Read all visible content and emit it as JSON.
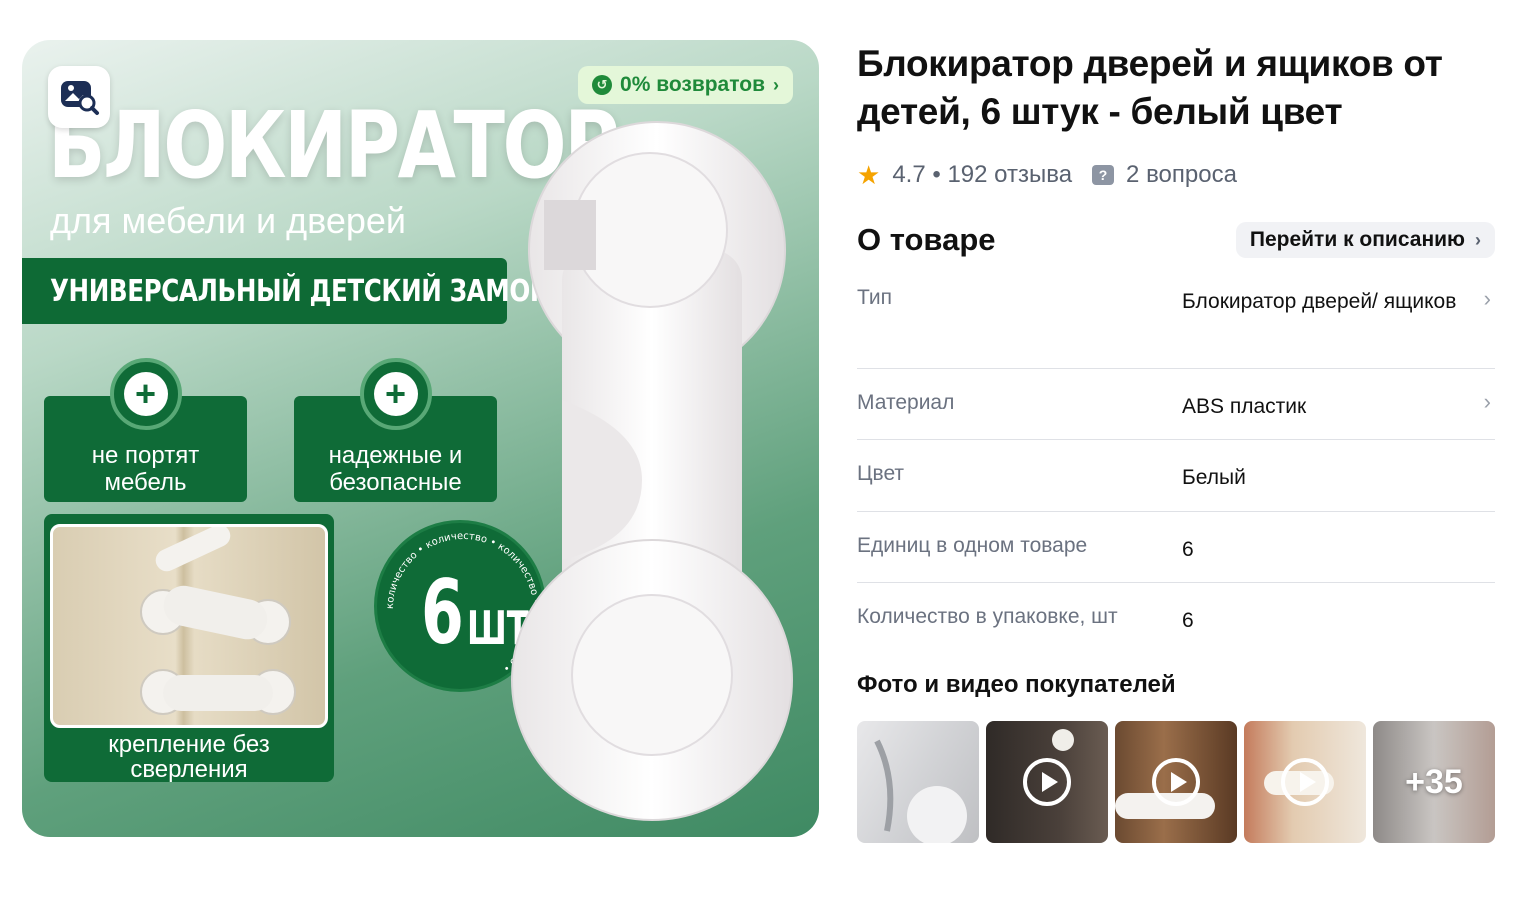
{
  "image": {
    "returns_badge": "0% возвратов",
    "hero_title": "БЛОКИРАТОР",
    "hero_subtitle": "для мебели и дверей",
    "banner": "УНИВЕРСАЛЬНЫЙ ДЕТСКИЙ ЗАМОК",
    "features": [
      {
        "line1": "не портят",
        "line2": "мебель"
      },
      {
        "line1": "надежные и",
        "line2": "безопасные"
      }
    ],
    "mount_caption_1": "крепление без",
    "mount_caption_2": "сверления",
    "seal_ring_text": "количество • количество • количество • количество •",
    "qty_number": "6",
    "qty_unit": "ШТ",
    "icons": {
      "visual_search": "image-search-icon",
      "returns": "return-arrow-icon",
      "plus": "plus-icon"
    },
    "colors": {
      "accent_green": "#0f6b37",
      "badge_bg": "#e4f7d9",
      "badge_text": "#1f8a3a"
    }
  },
  "product": {
    "title": "Блокиратор дверей и ящиков от детей, 6 штук - белый цвет",
    "rating": "4.7",
    "reviews": "192 отзыва",
    "questions": "2 вопроса"
  },
  "about": {
    "title": "О товаре",
    "description_link": "Перейти к описанию",
    "specs": [
      {
        "key": "Тип",
        "value": "Блокиратор дверей/ ящиков",
        "has_arrow": true
      },
      {
        "key": "Материал",
        "value": "ABS пластик",
        "has_arrow": true
      },
      {
        "key": "Цвет",
        "value": "Белый",
        "has_arrow": false
      },
      {
        "key": "Единиц в одном товаре",
        "value": "6",
        "has_arrow": false
      },
      {
        "key": "Количество в упаковке, шт",
        "value": "6",
        "has_arrow": false
      }
    ]
  },
  "customer_media": {
    "title": "Фото и видео покупателей",
    "thumbs": [
      {
        "type": "photo"
      },
      {
        "type": "video"
      },
      {
        "type": "video"
      },
      {
        "type": "video"
      },
      {
        "type": "more",
        "label": "+35"
      }
    ]
  }
}
